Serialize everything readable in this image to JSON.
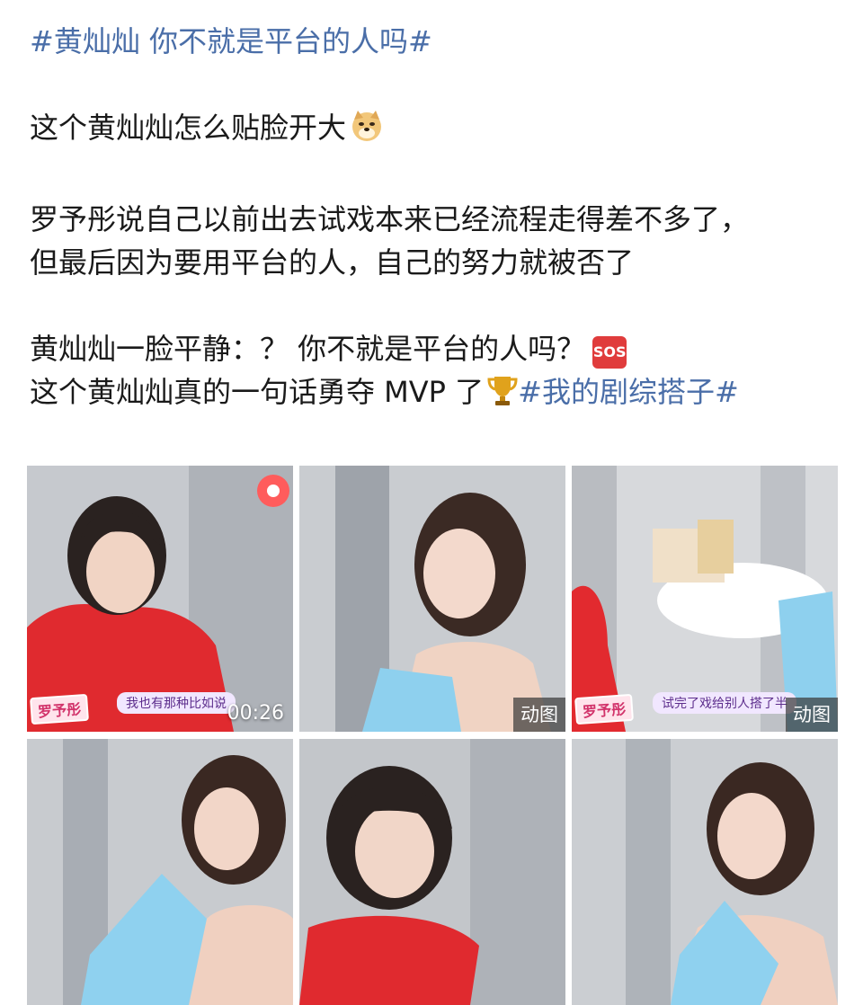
{
  "post": {
    "title_topic": "#黄灿灿 你不就是平台的人吗#",
    "line1": "这个黄灿灿怎么贴脸开大",
    "line1_emoji": "doge-icon",
    "line2": "罗予彤说自己以前出去试戏本来已经流程走得差不多了，",
    "line3": "但最后因为要用平台的人，自己的努力就被否了",
    "line4": "黄灿灿一脸平静：？ 你不就是平台的人吗？",
    "line4_badge": "SOS",
    "line5": "这个黄灿灿真的一句话勇夺 MVP 了",
    "line5_emoji": "trophy-icon",
    "line5_topic": "#我的剧综搭子#"
  },
  "colors": {
    "topic_link": "#4a6ea8",
    "sos_red": "#e03c3c",
    "trophy_gold": "#e0a21c"
  },
  "media": [
    {
      "type": "video",
      "caption_name": "罗予彤",
      "caption_text": "我也有那种比如说",
      "duration": "00:26"
    },
    {
      "type": "gif",
      "badge": "动图"
    },
    {
      "type": "gif",
      "caption_name": "罗予彤",
      "caption_text": "试完了戏给别人搭了半",
      "badge": "动图"
    },
    {
      "type": "image"
    },
    {
      "type": "image"
    },
    {
      "type": "image"
    }
  ]
}
